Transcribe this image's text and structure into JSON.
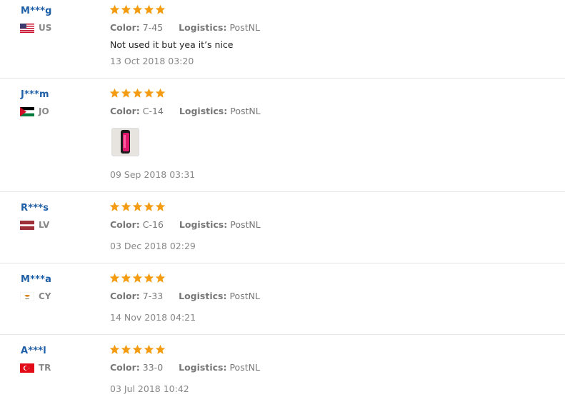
{
  "labels": {
    "color": "Color:",
    "logistics": "Logistics:"
  },
  "accent": {
    "user_link": "#1f5fa8",
    "star": "#f39c12"
  },
  "reviews": [
    {
      "user": "M***g",
      "country": "US",
      "flag_icon": "us-flag-icon",
      "rating": 5,
      "color": "7-45",
      "logistics": "PostNL",
      "comment": "Not used it but yea it’s nice",
      "date": "13 Oct 2018 03:20",
      "has_photo": false
    },
    {
      "user": "J***m",
      "country": "JO",
      "flag_icon": "jo-flag-icon",
      "rating": 5,
      "color": "C-14",
      "logistics": "PostNL",
      "comment": "",
      "date": "09 Sep 2018 03:31",
      "has_photo": true
    },
    {
      "user": "R***s",
      "country": "LV",
      "flag_icon": "lv-flag-icon",
      "rating": 5,
      "color": "C-16",
      "logistics": "PostNL",
      "comment": "",
      "date": "03 Dec 2018 02:29",
      "has_photo": false
    },
    {
      "user": "M***a",
      "country": "CY",
      "flag_icon": "cy-flag-icon",
      "rating": 5,
      "color": "7-33",
      "logistics": "PostNL",
      "comment": "",
      "date": "14 Nov 2018 04:21",
      "has_photo": false
    },
    {
      "user": "A***l",
      "country": "TR",
      "flag_icon": "tr-flag-icon",
      "rating": 5,
      "color": "33-0",
      "logistics": "PostNL",
      "comment": "",
      "date": "03 Jul 2018 10:42",
      "has_photo": false
    }
  ]
}
